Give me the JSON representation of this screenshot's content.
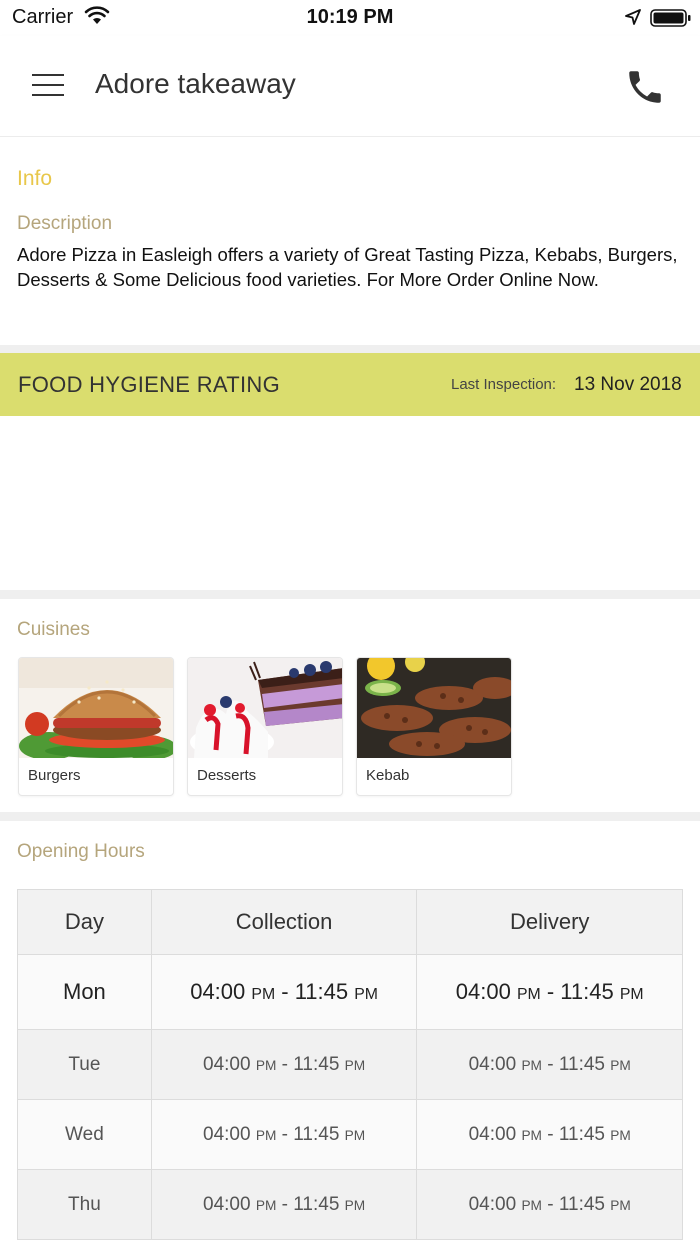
{
  "status_bar": {
    "carrier": "Carrier",
    "time": "10:19 PM"
  },
  "app_bar": {
    "title": "Adore takeaway"
  },
  "info": {
    "heading": "Info",
    "description_label": "Description",
    "description": "Adore Pizza in Easleigh offers a variety of Great Tasting Pizza, Kebabs, Burgers, Desserts & Some Delicious food varieties. For More Order Online Now."
  },
  "hygiene": {
    "title": "FOOD HYGIENE RATING",
    "last_inspection_label": "Last Inspection:",
    "last_inspection_date": "13 Nov 2018"
  },
  "cuisines": {
    "label": "Cuisines",
    "items": [
      {
        "name": "Burgers",
        "icon": "burger-image"
      },
      {
        "name": "Desserts",
        "icon": "dessert-image"
      },
      {
        "name": "Kebab",
        "icon": "kebab-image"
      }
    ]
  },
  "opening_hours": {
    "label": "Opening Hours",
    "columns": [
      "Day",
      "Collection",
      "Delivery"
    ],
    "rows": [
      {
        "day": "Mon",
        "collection": {
          "open": "04:00",
          "open_suffix": "PM",
          "close": "11:45",
          "close_suffix": "PM"
        },
        "delivery": {
          "open": "04:00",
          "open_suffix": "PM",
          "close": "11:45",
          "close_suffix": "PM"
        }
      },
      {
        "day": "Tue",
        "collection": {
          "open": "04:00",
          "open_suffix": "PM",
          "close": "11:45",
          "close_suffix": "PM"
        },
        "delivery": {
          "open": "04:00",
          "open_suffix": "PM",
          "close": "11:45",
          "close_suffix": "PM"
        }
      },
      {
        "day": "Wed",
        "collection": {
          "open": "04:00",
          "open_suffix": "PM",
          "close": "11:45",
          "close_suffix": "PM"
        },
        "delivery": {
          "open": "04:00",
          "open_suffix": "PM",
          "close": "11:45",
          "close_suffix": "PM"
        }
      },
      {
        "day": "Thu",
        "collection": {
          "open": "04:00",
          "open_suffix": "PM",
          "close": "11:45",
          "close_suffix": "PM"
        },
        "delivery": {
          "open": "04:00",
          "open_suffix": "PM",
          "close": "11:45",
          "close_suffix": "PM"
        }
      }
    ],
    "range_separator": " - "
  },
  "colors": {
    "accent_yellow": "#e8c74a",
    "label_tan": "#b5a57c",
    "hygiene_bar": "#dadd6e",
    "section_gap": "#efefef"
  }
}
